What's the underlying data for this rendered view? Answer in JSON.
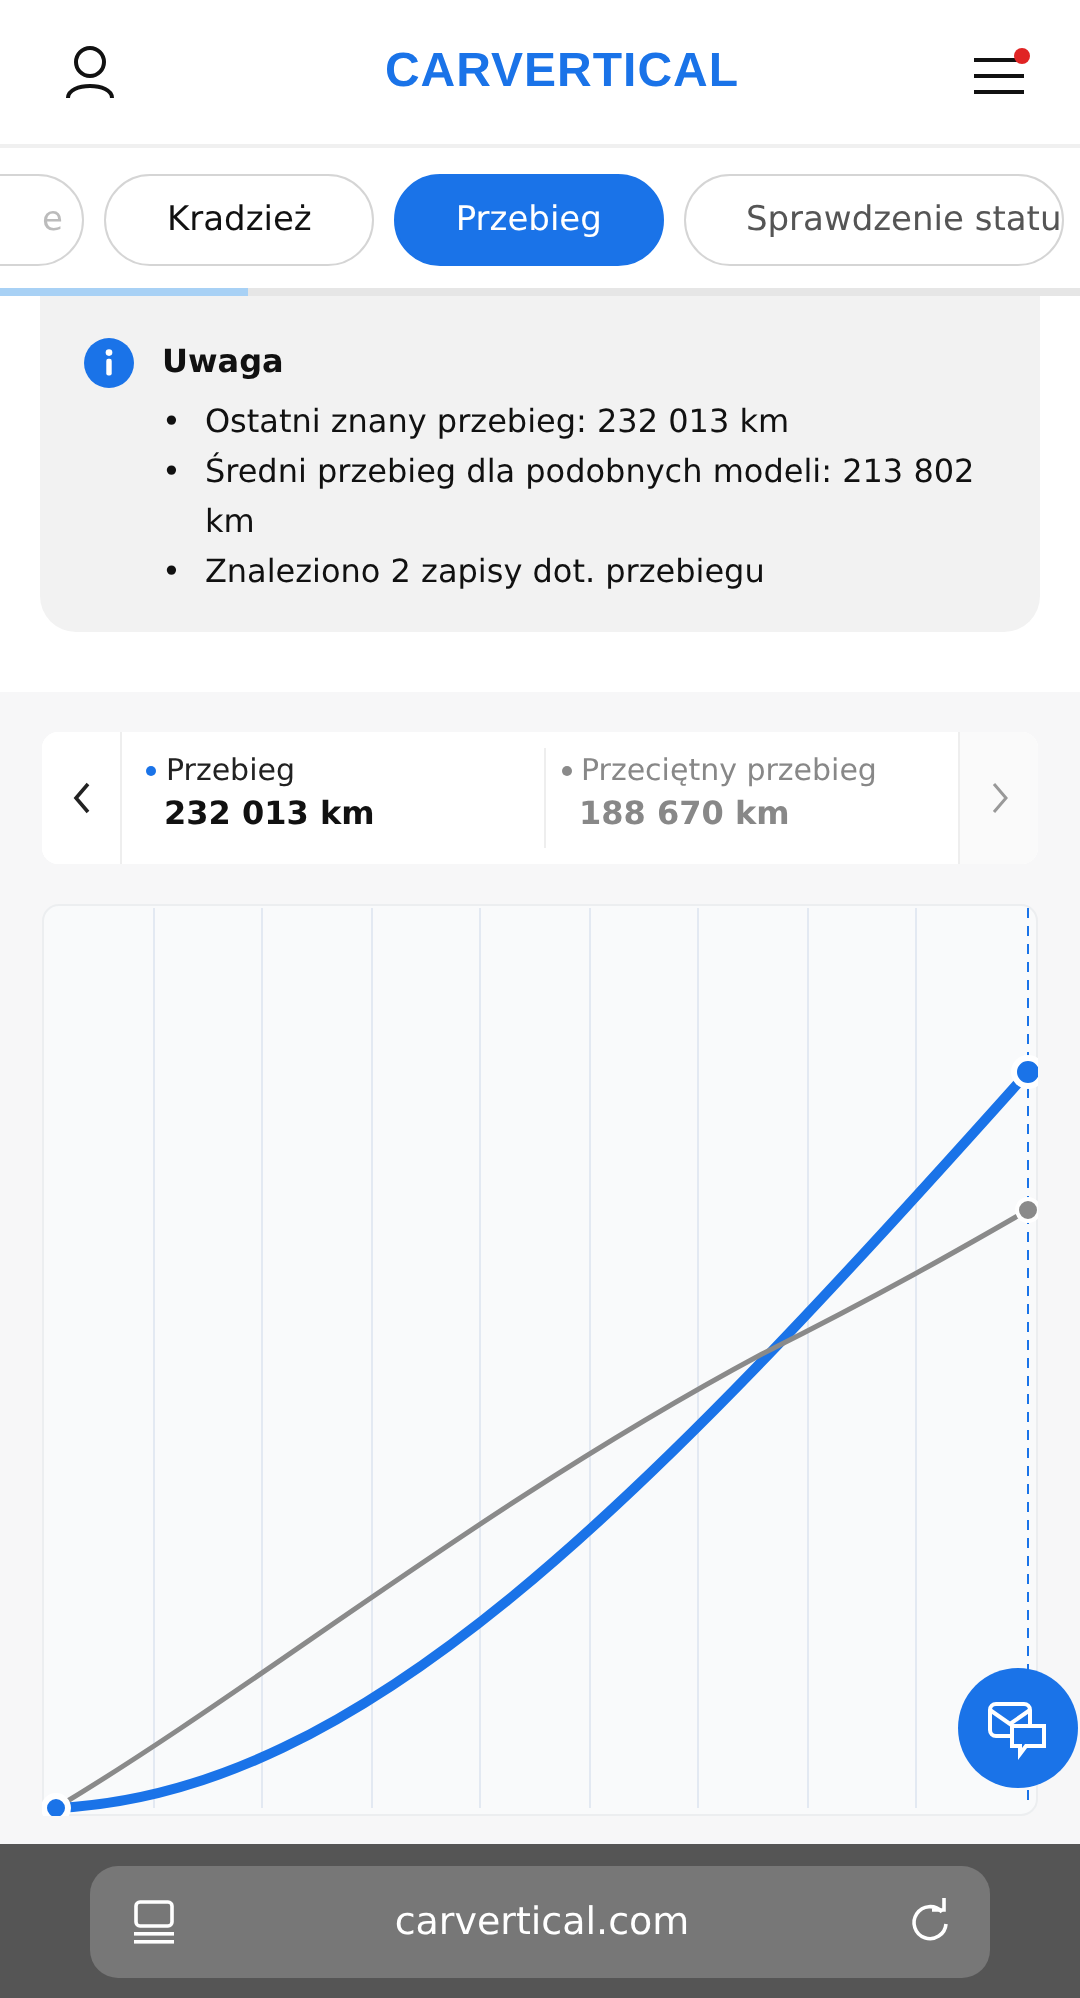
{
  "header": {
    "logo": "CARVERTICAL",
    "menu_notification": true
  },
  "tabs": [
    {
      "label": "e",
      "selected": false
    },
    {
      "label": "Kradzież",
      "selected": false
    },
    {
      "label": "Przebieg",
      "selected": true
    },
    {
      "label": "Sprawdzenie statu",
      "selected": false
    }
  ],
  "section_progress": {
    "level": 0.23
  },
  "notice": {
    "title": "Uwaga",
    "bullet": "•",
    "items": [
      "Ostatni znany przebieg: 232 013 km",
      "Średni przebieg dla podobnych modeli: 213 802 km",
      "Znaleziono 2 zapisy dot. przebiegu"
    ]
  },
  "legend": [
    {
      "name": "Przebieg",
      "value": "232 013 km",
      "color": "#1a73e8"
    },
    {
      "name": "Przeciętny przebieg",
      "value": "188 670 km",
      "color": "#8a8a8a"
    }
  ],
  "browser_bar": {
    "url": "carvertical.com"
  }
}
